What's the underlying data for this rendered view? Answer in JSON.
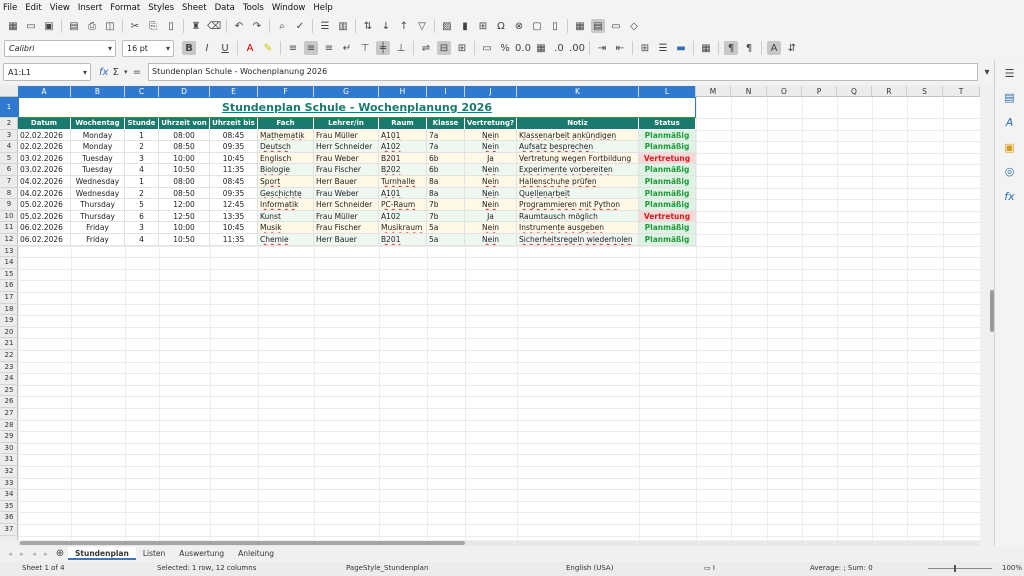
{
  "menu": [
    "File",
    "Edit",
    "View",
    "Insert",
    "Format",
    "Styles",
    "Sheet",
    "Data",
    "Tools",
    "Window",
    "Help"
  ],
  "toolbar": {
    "font_name": "Calibri",
    "font_size": "16 pt"
  },
  "formula": {
    "name_box": "A1:L1",
    "content": "Stundenplan Schule - Wochenplanung 2026",
    "fx": "fx",
    "sigma": "Σ",
    "equals": "="
  },
  "columns": [
    "A",
    "B",
    "C",
    "D",
    "E",
    "F",
    "G",
    "H",
    "I",
    "J",
    "K",
    "L",
    "M",
    "N",
    "O",
    "P",
    "Q",
    "R",
    "S",
    "T"
  ],
  "rows": [
    "1",
    "2",
    "3",
    "4",
    "5",
    "6",
    "7",
    "8",
    "9",
    "10",
    "11",
    "12",
    "13",
    "14",
    "15",
    "16",
    "17",
    "18",
    "19",
    "20",
    "21",
    "22",
    "23",
    "24",
    "25",
    "26",
    "27",
    "28",
    "29",
    "30",
    "31",
    "32",
    "33",
    "34",
    "35",
    "36",
    "37"
  ],
  "sheet": {
    "title": "Stundenplan Schule - Wochenplanung 2026",
    "headers": [
      "Datum",
      "Wochentag",
      "Stunde",
      "Uhrzeit von",
      "Uhrzeit bis",
      "Fach",
      "Lehrer/in",
      "Raum",
      "Klasse",
      "Vertretung?",
      "Notiz",
      "Status"
    ],
    "rows": [
      [
        "02.02.2026",
        "Monday",
        "1",
        "08:00",
        "08:45",
        "Mathematik",
        "Frau Müller",
        "A101",
        "7a",
        "Nein",
        "Klassenarbeit ankündigen",
        "Planmäßig"
      ],
      [
        "02.02.2026",
        "Monday",
        "2",
        "08:50",
        "09:35",
        "Deutsch",
        "Herr Schneider",
        "A102",
        "7a",
        "Nein",
        "Aufsatz besprechen",
        "Planmäßig"
      ],
      [
        "03.02.2026",
        "Tuesday",
        "3",
        "10:00",
        "10:45",
        "Englisch",
        "Frau Weber",
        "B201",
        "6b",
        "Ja",
        "Vertretung wegen Fortbildung",
        "Vertretung"
      ],
      [
        "03.02.2026",
        "Tuesday",
        "4",
        "10:50",
        "11:35",
        "Biologie",
        "Frau Fischer",
        "B202",
        "6b",
        "Nein",
        "Experimente vorbereiten",
        "Planmäßig"
      ],
      [
        "04.02.2026",
        "Wednesday",
        "1",
        "08:00",
        "08:45",
        "Sport",
        "Herr Bauer",
        "Turnhalle",
        "8a",
        "Nein",
        "Hallenschuhe prüfen",
        "Planmäßig"
      ],
      [
        "04.02.2026",
        "Wednesday",
        "2",
        "08:50",
        "09:35",
        "Geschichte",
        "Frau Weber",
        "A101",
        "8a",
        "Nein",
        "Quellenarbeit",
        "Planmäßig"
      ],
      [
        "05.02.2026",
        "Thursday",
        "5",
        "12:00",
        "12:45",
        "Informatik",
        "Herr Schneider",
        "PC-Raum",
        "7b",
        "Nein",
        "Programmieren mit Python",
        "Planmäßig"
      ],
      [
        "05.02.2026",
        "Thursday",
        "6",
        "12:50",
        "13:35",
        "Kunst",
        "Frau Müller",
        "A102",
        "7b",
        "Ja",
        "Raumtausch möglich",
        "Vertretung"
      ],
      [
        "06.02.2026",
        "Friday",
        "3",
        "10:00",
        "10:45",
        "Musik",
        "Frau Fischer",
        "Musikraum",
        "5a",
        "Nein",
        "Instrumente ausgeben",
        "Planmäßig"
      ],
      [
        "06.02.2026",
        "Friday",
        "4",
        "10:50",
        "11:35",
        "Chemie",
        "Herr Bauer",
        "B201",
        "5a",
        "Nein",
        "Sicherheitsregeln wiederholen",
        "Planmäßig"
      ]
    ]
  },
  "tabs": [
    "Stundenplan",
    "Listen",
    "Auswertung",
    "Anleitung"
  ],
  "status": {
    "sheet": "Sheet 1 of 4",
    "selected": "Selected: 1 row, 12 columns",
    "pagestyle": "PageStyle_Stundenplan",
    "lang": "English (USA)",
    "sum": "Average: ; Sum: 0",
    "zoom": "100%"
  },
  "colors": {
    "header": "#1a7a6e",
    "planmaessig": "#1f9a3a",
    "vertretung": "#d22020"
  }
}
